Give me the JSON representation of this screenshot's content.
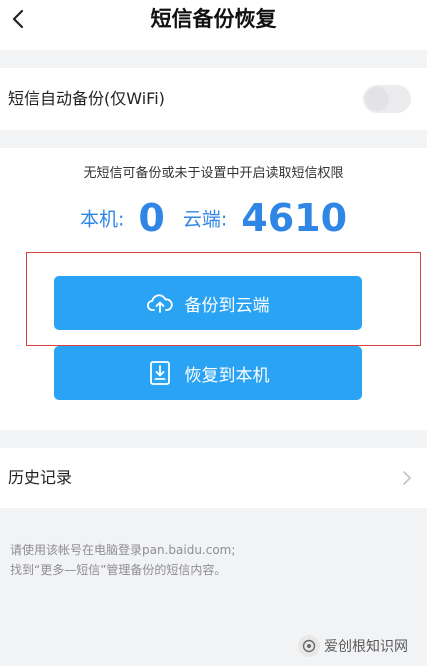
{
  "header": {
    "title": "短信备份恢复",
    "back_icon": "chevron-left-icon"
  },
  "auto_backup": {
    "label": "短信自动备份(仅WiFi)",
    "enabled": false
  },
  "summary": {
    "notice": "无短信可备份或未于设置中开启读取短信权限",
    "local_label": "本机:",
    "local_count": "0",
    "cloud_label": "云端:",
    "cloud_count": "4610"
  },
  "actions": {
    "backup_label": "备份到云端",
    "backup_icon": "cloud-upload-icon",
    "restore_label": "恢复到本机",
    "restore_icon": "download-to-device-icon"
  },
  "history": {
    "label": "历史记录"
  },
  "footer": {
    "line1": "请使用该帐号在电脑登录pan.baidu.com;",
    "line2": "找到“更多—短信”管理备份的短信内容。"
  },
  "watermark": {
    "text": "爱创根知识网"
  },
  "colors": {
    "accent": "#2aa3f5",
    "count_blue": "#2f86e4",
    "highlight_frame": "#d94040",
    "page_bg": "#f2f3f5"
  }
}
